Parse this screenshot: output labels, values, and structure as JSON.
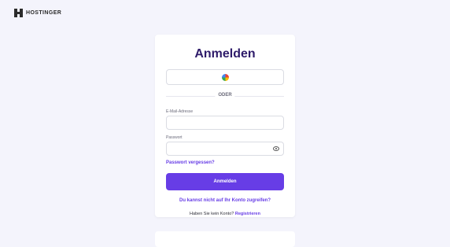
{
  "brand": {
    "name": "HOSTINGER"
  },
  "login": {
    "title": "Anmelden",
    "divider_text": "ODER",
    "email_label": "E-Mail-Adresse",
    "email_value": "",
    "password_label": "Passwort",
    "password_value": "",
    "forgot_password": "Passwort vergessen?",
    "submit_label": "Anmelden",
    "no_access": "Du kannst nicht auf Ihr Konto zugreifen?",
    "no_account_text": "Haben Sie kein Konto?",
    "register_link": "Registrieren"
  },
  "colors": {
    "accent": "#673de6",
    "title": "#2f1c6a",
    "background": "#f4f4fc"
  },
  "icons": {
    "logo": "hostinger-logo",
    "google": "google-icon",
    "eye": "eye-icon"
  }
}
